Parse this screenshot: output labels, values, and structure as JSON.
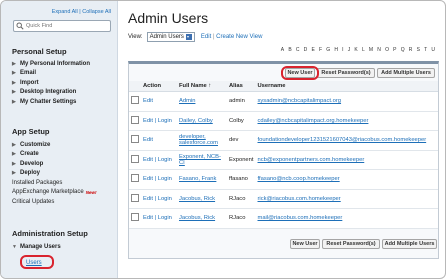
{
  "sidebar": {
    "expand_all": "Expand All",
    "separator": "|",
    "collapse_all": "Collapse All",
    "quick_find_placeholder": "Quick Find",
    "personal_setup": {
      "title": "Personal Setup",
      "items": [
        "My Personal Information",
        "Email",
        "Import",
        "Desktop Integration",
        "My Chatter Settings"
      ]
    },
    "app_setup": {
      "title": "App Setup",
      "items": [
        "Customize",
        "Create",
        "Develop",
        "Deploy"
      ],
      "sub_items": [
        "Installed Packages",
        "AppExchange Marketplace",
        "Critical Updates"
      ],
      "new_badge": "New!"
    },
    "admin_setup": {
      "title": "Administration Setup",
      "manage_users": "Manage Users",
      "users_link": "Users"
    }
  },
  "main": {
    "title": "Admin Users",
    "view_label": "View:",
    "view_value": "Admin Users",
    "edit_link": "Edit",
    "separator": "|",
    "create_link": "Create New View",
    "alphabet": [
      "A",
      "B",
      "C",
      "D",
      "E",
      "F",
      "G",
      "H",
      "I",
      "J",
      "K",
      "L",
      "M",
      "N",
      "O",
      "P",
      "Q",
      "R",
      "S",
      "T",
      "U"
    ],
    "buttons": {
      "new_user": "New User",
      "reset_passwords": "Reset Password(s)",
      "add_multiple": "Add Multiple Users"
    },
    "columns": [
      "Action",
      "Full Name ↑",
      "Alias",
      "Username"
    ],
    "rows": [
      {
        "actions": "Edit",
        "full_name": "Admin",
        "alias": "admin",
        "username": "sysadmin@ncbcapitalimpact.org"
      },
      {
        "actions": "Edit | Login",
        "full_name": "Dailey, Colby",
        "alias": "Colby",
        "username": "cdailey@ncbcapitalimpact.org.homekeeper"
      },
      {
        "actions": "Edit",
        "full_name": "developer, salesforce.com",
        "alias": "dev",
        "username": "foundationdeveloper1231521607043@riacobus.com.homekeeper"
      },
      {
        "actions": "Edit | Login",
        "full_name": "Exponent, NCB-CI",
        "alias": "Exponent",
        "username": "ncb@exponentpartners.com.homekeeper"
      },
      {
        "actions": "Edit | Login",
        "full_name": "Fasano, Frank",
        "alias": "ffasano",
        "username": "ffasano@ncb.coop.homekeeper"
      },
      {
        "actions": "Edit | Login",
        "full_name": "Jacobus, Rick",
        "alias": "RJaco",
        "username": "rick@riacobus.com.homekeeper"
      },
      {
        "actions": "Edit | Login",
        "full_name": "Jacobus, Rick",
        "alias": "RJaco",
        "username": "mail@riacobus.com.homekeeper"
      }
    ]
  }
}
